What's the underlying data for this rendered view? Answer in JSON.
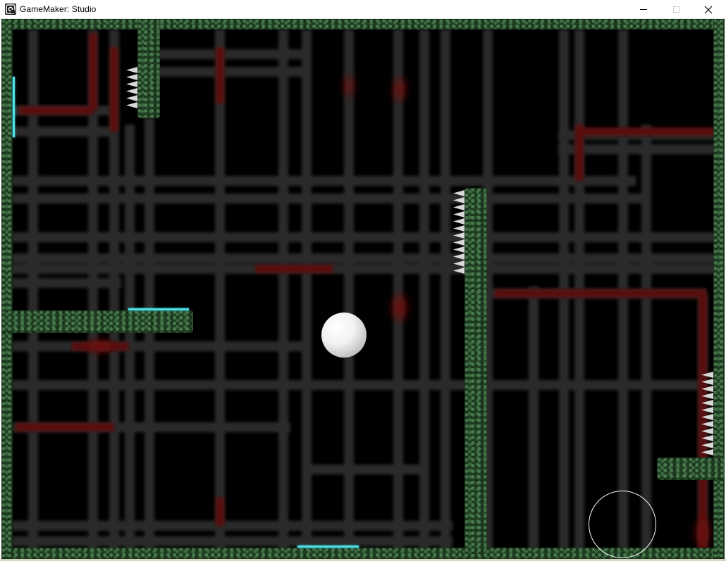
{
  "window": {
    "title": "GameMaker: Studio",
    "icon": "gamemaker-icon",
    "controls": [
      "minimize-icon",
      "maximize-icon",
      "close-icon"
    ]
  },
  "game": {
    "background_color": "#000000",
    "wall_color": "#2b4f2e",
    "spike_color": "#d8d8d8",
    "marker_color": "#4fe0e8",
    "ball_color": "#f0f0f0",
    "ring_color": "#ffffff"
  }
}
